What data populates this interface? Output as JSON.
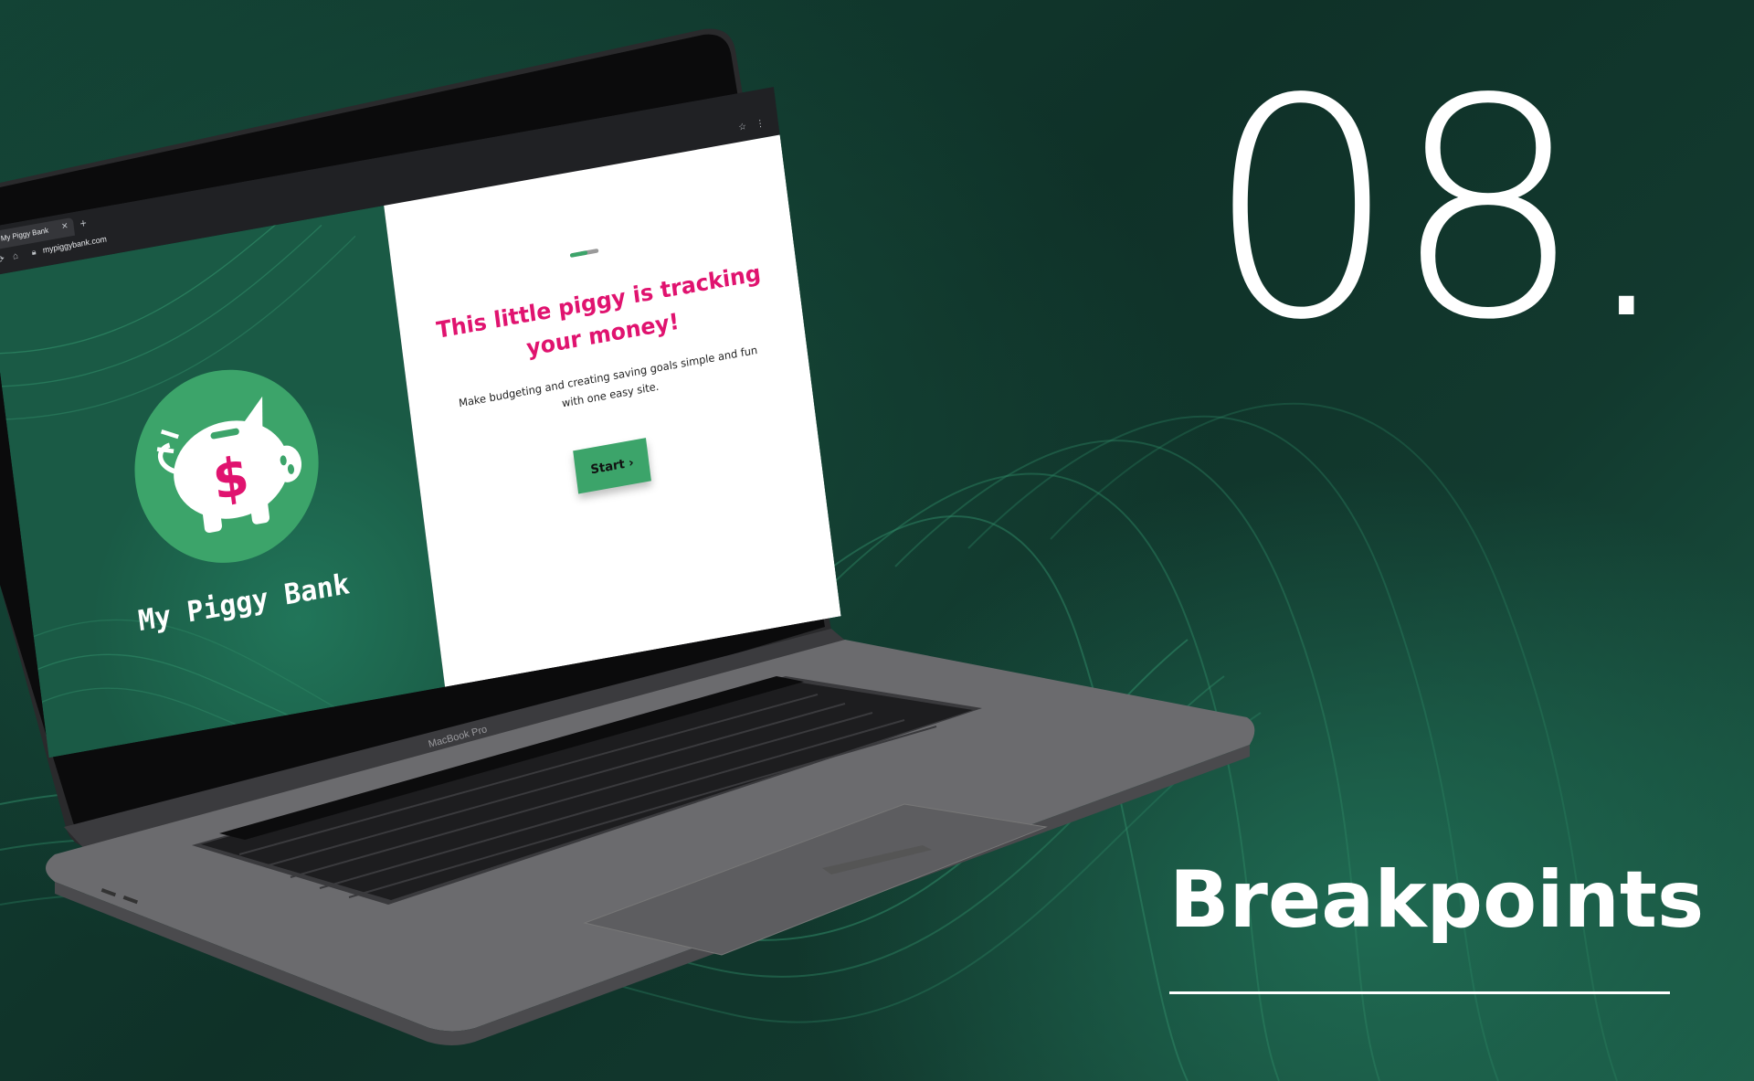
{
  "slide": {
    "number": "08.",
    "title": "Breakpoints"
  },
  "browser": {
    "tab_title": "My Piggy Bank",
    "tab_close": "✕",
    "new_tab": "+",
    "url": "mypiggybank.com",
    "reload_icon": "reload-icon",
    "home_icon": "home-icon",
    "lock_icon": "lock-icon",
    "star_icon": "star-icon",
    "menu_icon": "kebab-menu-icon"
  },
  "app": {
    "brand": "My Piggy Bank",
    "logo_icon": "piggy-bank-dollar-icon",
    "headline": "This little piggy is tracking your money!",
    "subtext": "Make budgeting and creating saving goals simple and fun with one easy site.",
    "start_label": "Start ›",
    "progress": 0.6
  },
  "device": {
    "label": "MacBook Pro"
  },
  "colors": {
    "background": "#134335",
    "brand_green": "#3ca46a",
    "headline_pink": "#e0136f",
    "app_left_pane": "#1a5a45"
  }
}
